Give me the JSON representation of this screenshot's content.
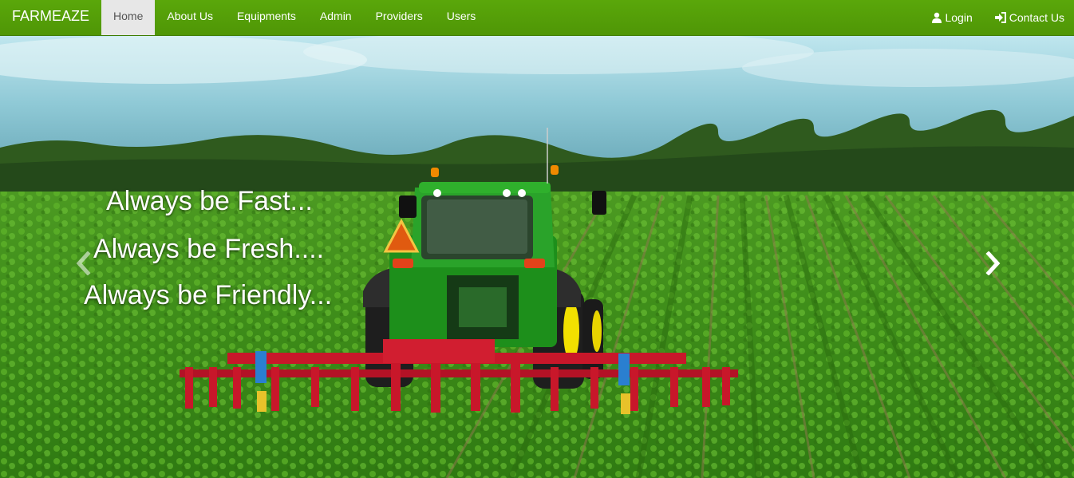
{
  "navbar": {
    "brand": "FARMEAZE",
    "items": [
      {
        "label": "Home"
      },
      {
        "label": "About Us"
      },
      {
        "label": "Equipments"
      },
      {
        "label": "Admin"
      },
      {
        "label": "Providers"
      },
      {
        "label": "Users"
      }
    ],
    "right": {
      "login": {
        "label": "Login",
        "icon": "user-icon"
      },
      "contact": {
        "label": "Contact Us",
        "icon": "log-in-icon"
      }
    }
  },
  "carousel": {
    "captions": [
      "Always be Fast...",
      "Always be Fresh....",
      "Always be Friendly..."
    ],
    "prev_icon": "chevron-left-icon",
    "next_icon": "chevron-right-icon"
  },
  "colors": {
    "navbar": "#55a008",
    "active_tab": "#e7e7e7"
  }
}
